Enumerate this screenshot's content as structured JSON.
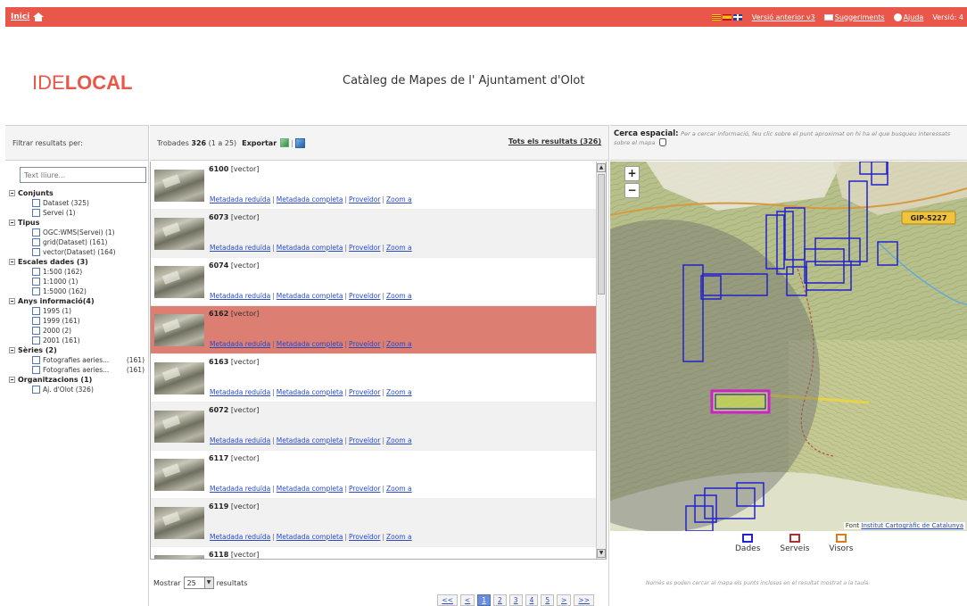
{
  "topbar": {
    "home_label": "Inici",
    "prev_version": "Versió anterior v3",
    "suggestions": "Suggeriments",
    "help": "Ajuda",
    "version": "Versió: 4"
  },
  "header": {
    "logo_ide": "IDE",
    "logo_local": "LOCAL",
    "title": "Catàleg de Mapes de l' Ajuntament d'Olot"
  },
  "filter": {
    "heading": "Filtrar resultats per:",
    "placeholder": "Text lliure...",
    "groups": [
      {
        "label": "Conjunts",
        "items": [
          {
            "label": "Dataset (325)",
            "count": ""
          },
          {
            "label": "Servei (1)",
            "count": ""
          }
        ]
      },
      {
        "label": "Tipus",
        "items": [
          {
            "label": "OGC:WMS(Servei) (1)",
            "count": ""
          },
          {
            "label": "grid(Dataset) (161)",
            "count": ""
          },
          {
            "label": "vector(Dataset) (164)",
            "count": ""
          }
        ]
      },
      {
        "label": "Escales dades (3)",
        "items": [
          {
            "label": "1:500 (162)",
            "count": ""
          },
          {
            "label": "1:1000 (1)",
            "count": ""
          },
          {
            "label": "1:5000 (162)",
            "count": ""
          }
        ]
      },
      {
        "label": "Anys informació(4)",
        "items": [
          {
            "label": "1995 (1)",
            "count": ""
          },
          {
            "label": "1999 (161)",
            "count": ""
          },
          {
            "label": "2000 (2)",
            "count": ""
          },
          {
            "label": "2001 (161)",
            "count": ""
          }
        ]
      },
      {
        "label": "Sèries (2)",
        "items": [
          {
            "label": "Fotografies aeries...",
            "count": "(161)"
          },
          {
            "label": "Fotografies aeries...",
            "count": "(161)"
          }
        ]
      },
      {
        "label": "Organitzacions (1)",
        "items": [
          {
            "label": "Aj. d'Olot (326)",
            "count": ""
          }
        ]
      }
    ]
  },
  "results_header": {
    "found_prefix": "Trobades",
    "found_count": "326",
    "found_range": "(1 a 25)",
    "export": "Exportar",
    "all_results": "Tots els resultats (326)"
  },
  "link_labels": {
    "reduced": "Metadada reduïda",
    "full": "Metadada completa",
    "provider": "Proveïdor",
    "zoom": "Zoom a"
  },
  "results": [
    {
      "id": "6100",
      "type": "[vector]"
    },
    {
      "id": "6073",
      "type": "[vector]"
    },
    {
      "id": "6074",
      "type": "[vector]"
    },
    {
      "id": "6162",
      "type": "[vector]"
    },
    {
      "id": "6163",
      "type": "[vector]"
    },
    {
      "id": "6072",
      "type": "[vector]"
    },
    {
      "id": "6117",
      "type": "[vector]"
    },
    {
      "id": "6119",
      "type": "[vector]"
    },
    {
      "id": "6118",
      "type": "[vector]"
    }
  ],
  "selected_index": 3,
  "pager": {
    "show_label": "Mostrar",
    "per_page": "25",
    "results_label": "resultats",
    "pages": [
      "<<",
      "<",
      "1",
      "2",
      "3",
      "4",
      "5",
      ">",
      ">>"
    ],
    "active_page": "1"
  },
  "spatial": {
    "title": "Cerca espacial:",
    "hint": "Per a cercar informació, feu clic sobre el punt aproximat on hi ha el que busqueu interessats sobre el mapa",
    "zoom_in": "+",
    "zoom_out": "−",
    "credit_prefix": "Font",
    "credit_link": "Institut Cartogràfic de Catalunya",
    "road_label": "GIP-5227",
    "footnote": "Només es poden cercar al mapa els punts inclosos en el resultat mostrat a la taula."
  },
  "legend": [
    {
      "label": "Dades",
      "color": "#2222cc"
    },
    {
      "label": "Serveis",
      "color": "#b03030"
    },
    {
      "label": "Visors",
      "color": "#e07a1a"
    }
  ],
  "colors": {
    "accent": "#e8574a",
    "selected_row": "#dc7e72",
    "link": "#2a4bc8",
    "highlight_box": "#cc22cc"
  }
}
